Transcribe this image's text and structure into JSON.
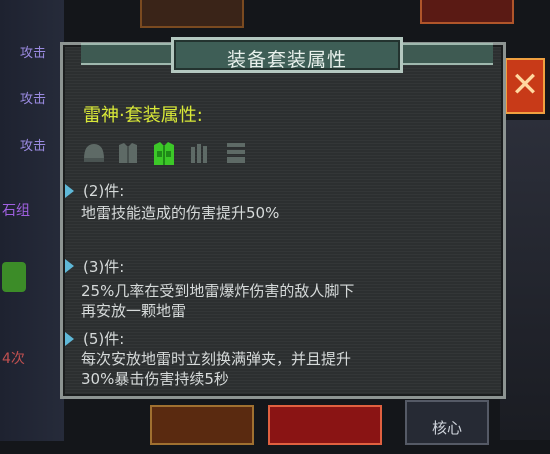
{
  "background": {
    "left_labels": [
      "攻击",
      "攻击",
      "攻击",
      "石组",
      "4次"
    ],
    "core_label": "核心",
    "close_symbol": "✕"
  },
  "panel": {
    "title": "装备套装属性",
    "set_name": "雷神·套装属性:",
    "set_icons": [
      {
        "name": "helmet-icon",
        "active": false
      },
      {
        "name": "armor-icon",
        "active": false
      },
      {
        "name": "vest-icon",
        "active": true
      },
      {
        "name": "gloves-icon",
        "active": false
      },
      {
        "name": "boots-icon",
        "active": false
      }
    ],
    "bonuses": [
      {
        "pieces": "(2)件:",
        "lines": [
          "地雷技能造成的伤害提升50%"
        ]
      },
      {
        "pieces": "(3)件:",
        "lines": [
          "25%几率在受到地雷爆炸伤害的敌人脚下",
          "再安放一颗地雷"
        ]
      },
      {
        "pieces": "(5)件:",
        "lines": [
          "每次安放地雷时立刻换满弹夹，并且提升",
          "30%暴击伤害持续5秒"
        ]
      }
    ]
  },
  "colors": {
    "set_name": "#d8e838",
    "bullet": "#5fb8d8",
    "active_icon": "#3cc828",
    "inactive_icon": "#5e6a66"
  }
}
